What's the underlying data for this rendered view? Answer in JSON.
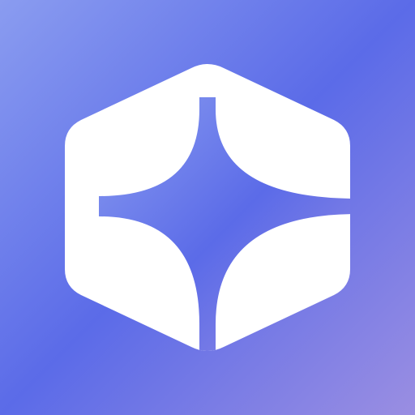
{
  "icon": {
    "name": "hexagon-sparkle-logo",
    "colors": {
      "gradient_start": "#8A9CF0",
      "gradient_mid": "#5B6BE8",
      "gradient_end": "#9A8EE2",
      "mark": "#FFFFFF"
    }
  }
}
